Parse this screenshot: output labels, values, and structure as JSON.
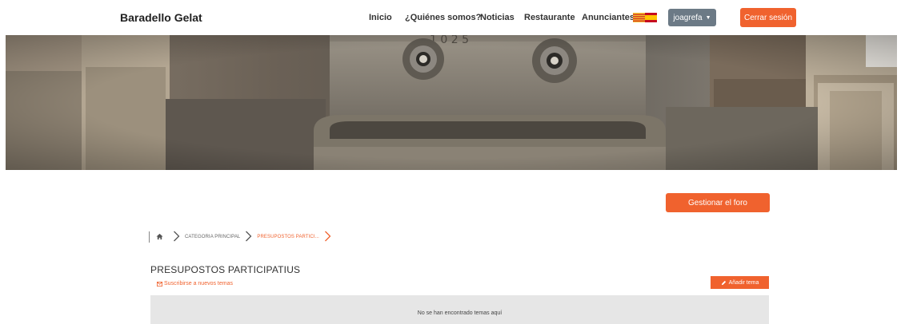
{
  "navbar": {
    "brand": "Baradello Gelat",
    "links": [
      "Inicio",
      "¿Quiénes somos?",
      "Noticias",
      "Restaurante",
      "Anunciantes"
    ],
    "flag_icon": "language-flag-icon",
    "user_menu": "joagrefa",
    "logout_label": "Cerrar sesión"
  },
  "hero": {
    "icon": "fountain-photo"
  },
  "forum": {
    "manage_label": "Gestionar el foro",
    "breadcrumb": {
      "home_icon": "home-icon",
      "items": [
        "CATEGORIA PRINCIPAL",
        "PRESUPOSTOS PARTICI..."
      ]
    },
    "title": "PRESUPOSTOS PARTICIPATIUS",
    "subscribe_label": "Suscribirse a nuevos temas",
    "add_topic_label": "Añadir tema",
    "empty_message": "No se han encontrado temas aquí"
  },
  "colors": {
    "accent": "#f0622e",
    "user_button": "#6c7a86",
    "empty_box": "#e6e6e6"
  }
}
